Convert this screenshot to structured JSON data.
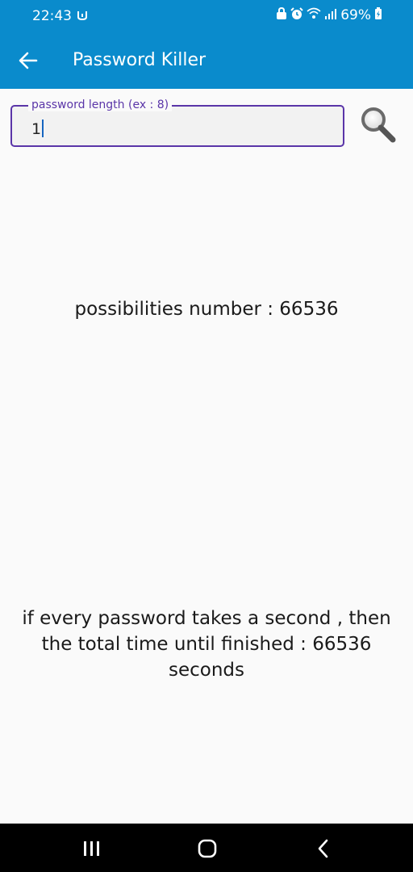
{
  "status_bar": {
    "time": "22:43",
    "battery": "69%",
    "icons": [
      "mi-icon",
      "lock-icon",
      "alarm-icon",
      "wifi-icon",
      "signal-icon",
      "battery-icon"
    ]
  },
  "app_bar": {
    "title": "Password Killer",
    "back_icon": "arrow-left-icon"
  },
  "input": {
    "label": "password length (ex : 8)",
    "value": "1"
  },
  "search_icon": "search-icon",
  "results": {
    "possibilities": "possibilities number : 66536",
    "total_time": "if every password takes a second , then the total time until finished : 66536 seconds"
  },
  "nav_bar": {
    "icons": [
      "recents-icon",
      "home-icon",
      "back-icon"
    ]
  },
  "colors": {
    "primary": "#0a8bcc",
    "accent": "#5a35a8",
    "background": "#fafafa"
  }
}
